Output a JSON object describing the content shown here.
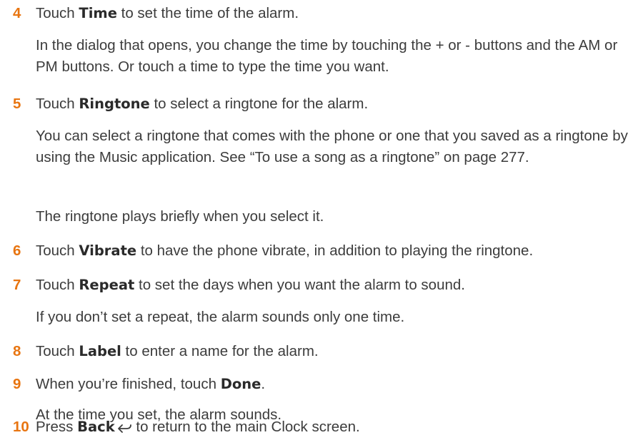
{
  "steps": [
    {
      "number": "4",
      "pre": "Touch ",
      "bold": "Time",
      "post": " to set the time of the alarm.",
      "details": [
        "In the dialog that opens, you change the time by touching the + or - buttons and the AM or PM buttons. Or touch a time to type the time you want."
      ]
    },
    {
      "number": "5",
      "pre": "Touch ",
      "bold": "Ringtone",
      "post": " to select a ringtone for the alarm.",
      "details": [
        "You can select a ringtone that comes with the phone or one that you saved as a ringtone by using the Music application. See “To use a song as a ringtone” on page 277.",
        "The ringtone plays briefly when you select it."
      ]
    },
    {
      "number": "6",
      "pre": "Touch ",
      "bold": "Vibrate",
      "post": " to have the phone vibrate, in addition to playing the ringtone.",
      "details": []
    },
    {
      "number": "7",
      "pre": "Touch ",
      "bold": "Repeat",
      "post": " to set the days when you want the alarm to sound.",
      "details": [
        "If you don’t set a repeat, the alarm sounds only one time."
      ]
    },
    {
      "number": "8",
      "pre": "Touch ",
      "bold": "Label",
      "post": " to enter a name for the alarm.",
      "details": []
    },
    {
      "number": "9",
      "pre": "When you’re finished, touch ",
      "bold": "Done",
      "post": ".",
      "details": [
        "At the time you set, the alarm sounds."
      ]
    },
    {
      "number": "10",
      "pre": "Press ",
      "bold": "Back",
      "icon": "back-arrow-icon",
      "post": " to return to the main Clock screen.",
      "details": []
    }
  ],
  "colors": {
    "step_number": "#e87511",
    "text": "#3c3c3c"
  }
}
